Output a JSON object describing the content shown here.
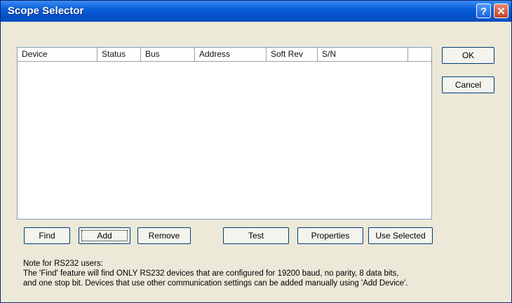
{
  "window": {
    "title": "Scope Selector",
    "help_glyph": "?",
    "close_glyph": "✕"
  },
  "device_list": {
    "columns": [
      "Device",
      "Status",
      "Bus",
      "Address",
      "Soft Rev",
      "S/N",
      ""
    ],
    "rows": []
  },
  "buttons": {
    "ok": "OK",
    "cancel": "Cancel",
    "find": "Find",
    "add": "Add",
    "remove": "Remove",
    "test": "Test",
    "properties": "Properties",
    "use_selected": "Use Selected"
  },
  "note": {
    "heading": "Note for RS232 users:",
    "line1": "The 'Find' feature will find ONLY RS232 devices that are configured for 19200 baud, no parity, 8 data bits,",
    "line2": "and one stop bit. Devices that use other communication settings can be added manually using 'Add Device'."
  },
  "colors": {
    "titlebar": "#0a5fd8",
    "dialog_bg": "#ece9d8",
    "button_border": "#003c74"
  },
  "icons": [
    "help-icon",
    "close-icon"
  ]
}
